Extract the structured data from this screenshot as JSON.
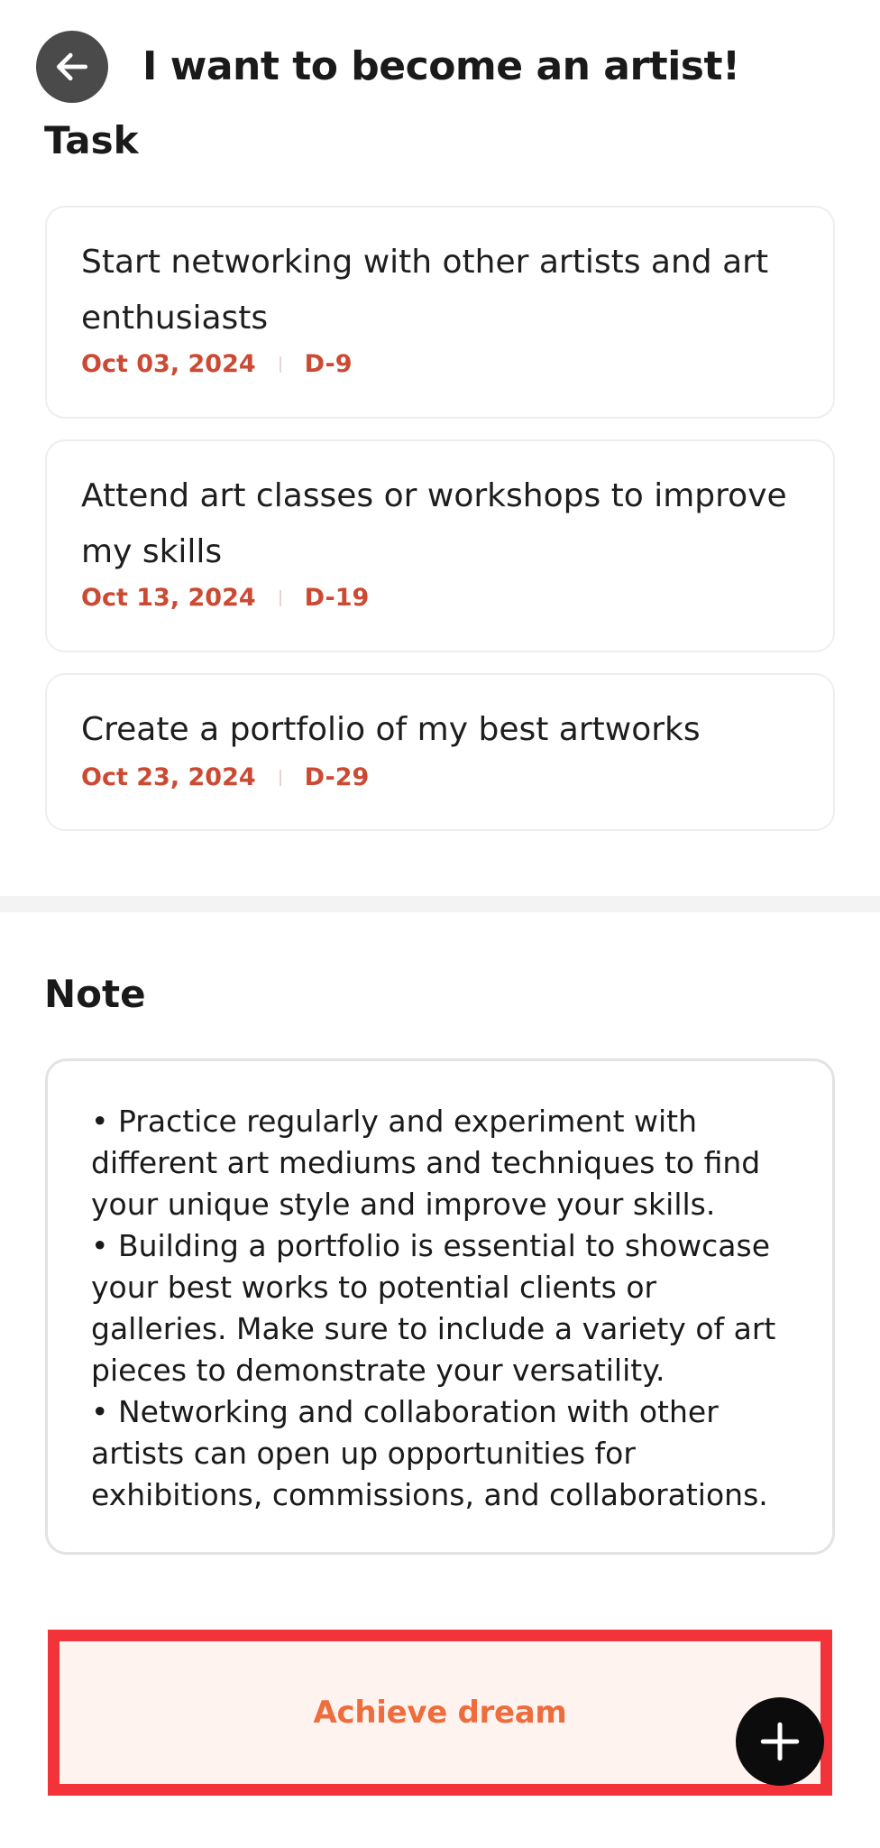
{
  "header": {
    "title": "I want to become an artist!",
    "back_icon": "arrow-left-icon"
  },
  "tasks": {
    "section_title": "Task",
    "items": [
      {
        "text": "Start networking with other artists and art enthusiasts",
        "date": "Oct 03, 2024",
        "dday": "D-9"
      },
      {
        "text": "Attend art classes or workshops to improve my skills",
        "date": "Oct 13, 2024",
        "dday": "D-19"
      },
      {
        "text": "Create a portfolio of my best artworks",
        "date": "Oct 23, 2024",
        "dday": "D-29"
      }
    ]
  },
  "note": {
    "section_title": "Note",
    "content": "• Practice regularly and experiment with different art mediums and techniques to find your unique style and improve your skills.\n• Building a portfolio is essential to showcase your best works to potential clients or galleries. Make sure to include a variety of art pieces to demonstrate your versatility.\n• Networking and collaboration with other artists can open up opportunities for exhibitions, commissions, and collaborations."
  },
  "actions": {
    "achieve_label": "Achieve dream",
    "fab_icon": "plus-icon"
  },
  "colors": {
    "accent_date": "#cc4a34",
    "achieve_text": "#ee6d3d",
    "achieve_bg": "#fff3f0",
    "highlight_border": "#f2333a"
  }
}
